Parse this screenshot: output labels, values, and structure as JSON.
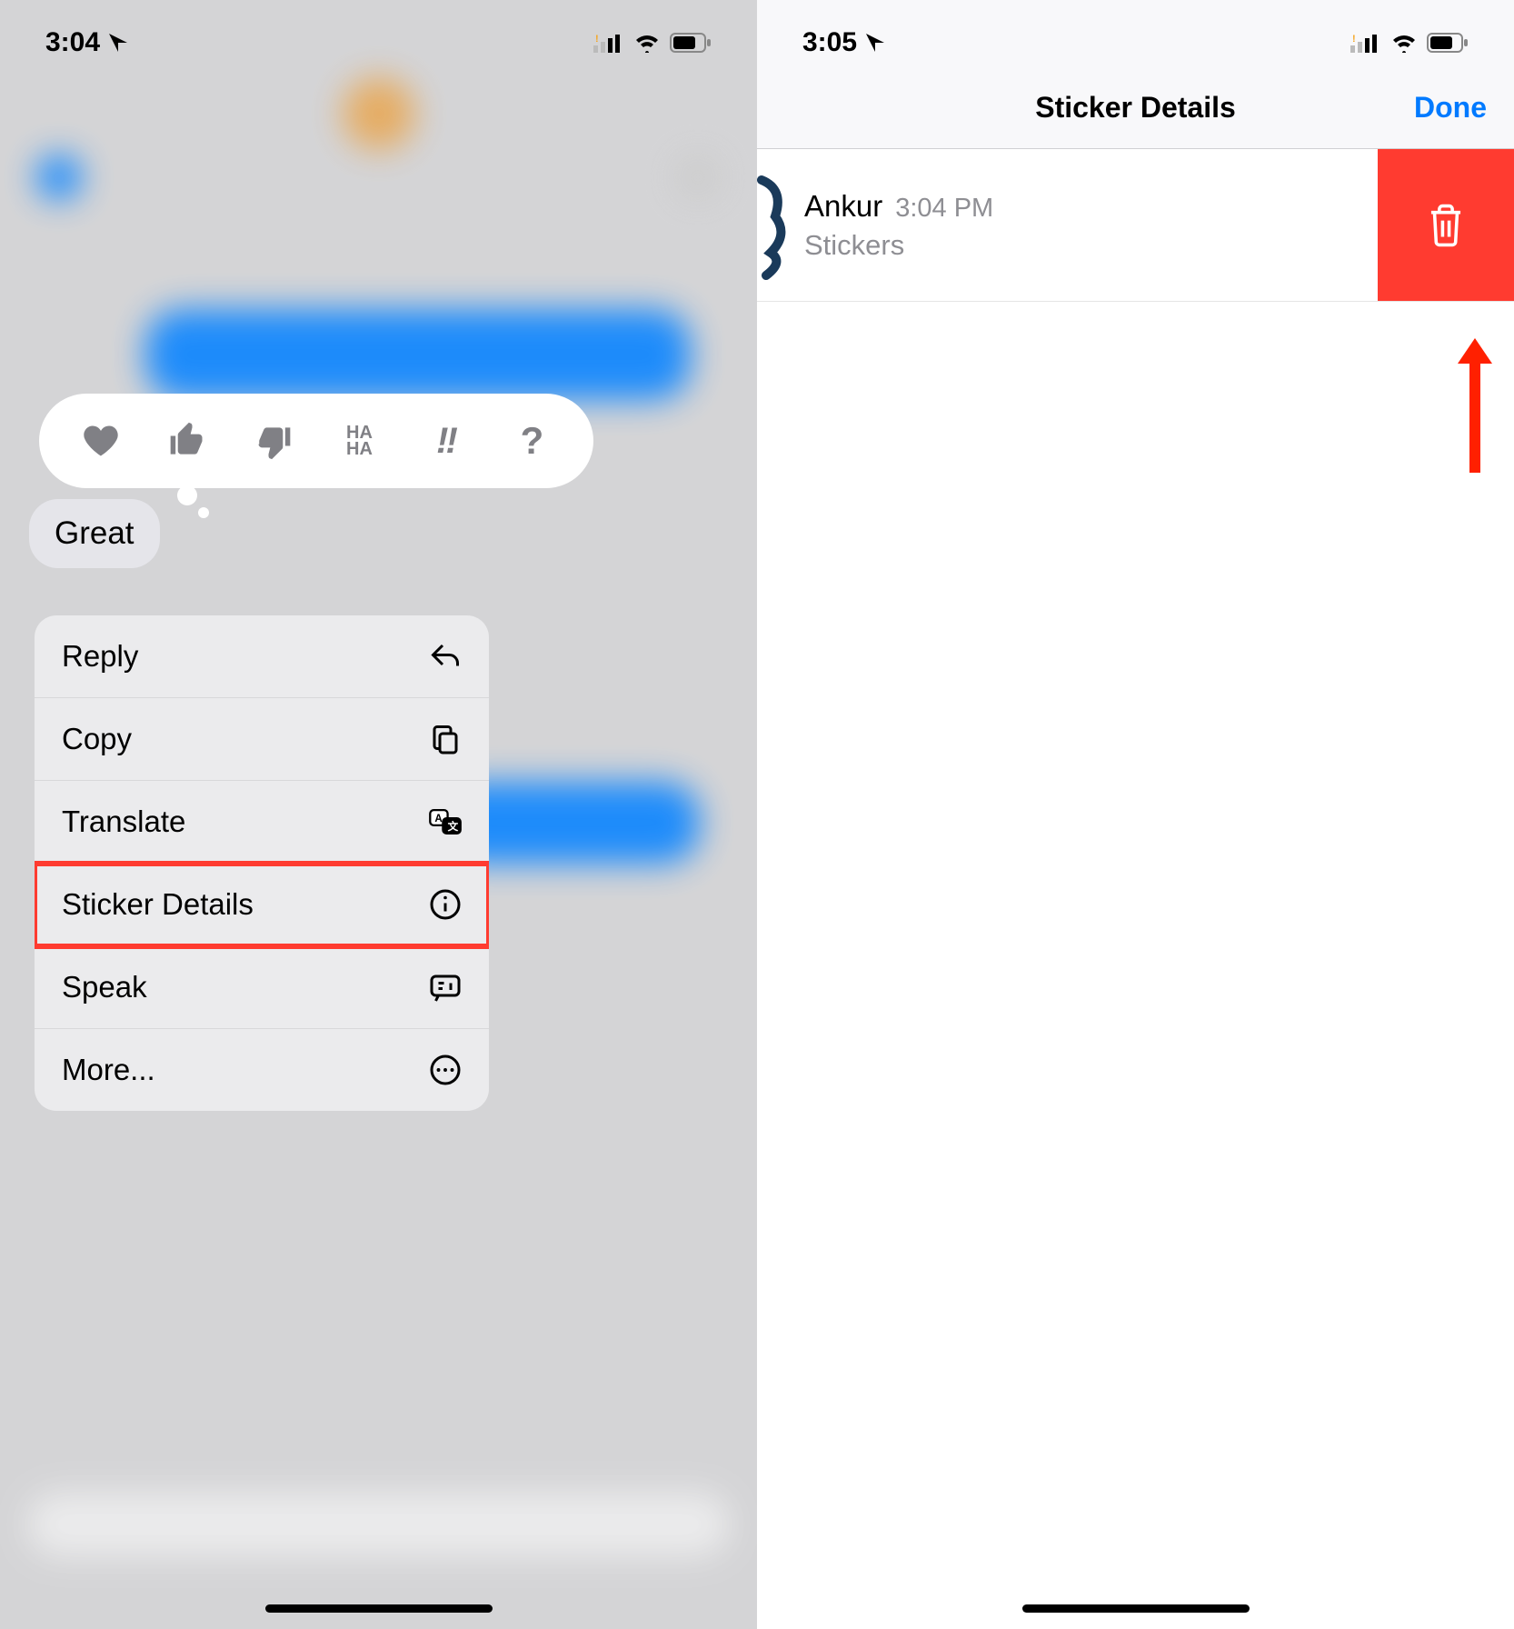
{
  "left": {
    "status": {
      "time": "3:04"
    },
    "message": "Great",
    "tapbacks": {
      "haha": "HA\nHA",
      "excl": "!!",
      "question": "?"
    },
    "menu": [
      {
        "label": "Reply",
        "icon": "reply",
        "highlight": false
      },
      {
        "label": "Copy",
        "icon": "copy",
        "highlight": false
      },
      {
        "label": "Translate",
        "icon": "translate",
        "highlight": false
      },
      {
        "label": "Sticker Details",
        "icon": "info",
        "highlight": true
      },
      {
        "label": "Speak",
        "icon": "speak",
        "highlight": false
      },
      {
        "label": "More...",
        "icon": "more",
        "highlight": false
      }
    ]
  },
  "right": {
    "status": {
      "time": "3:05"
    },
    "nav": {
      "title": "Sticker Details",
      "done": "Done"
    },
    "row": {
      "name": "Ankur",
      "time": "3:04 PM",
      "sub": "Stickers"
    }
  }
}
